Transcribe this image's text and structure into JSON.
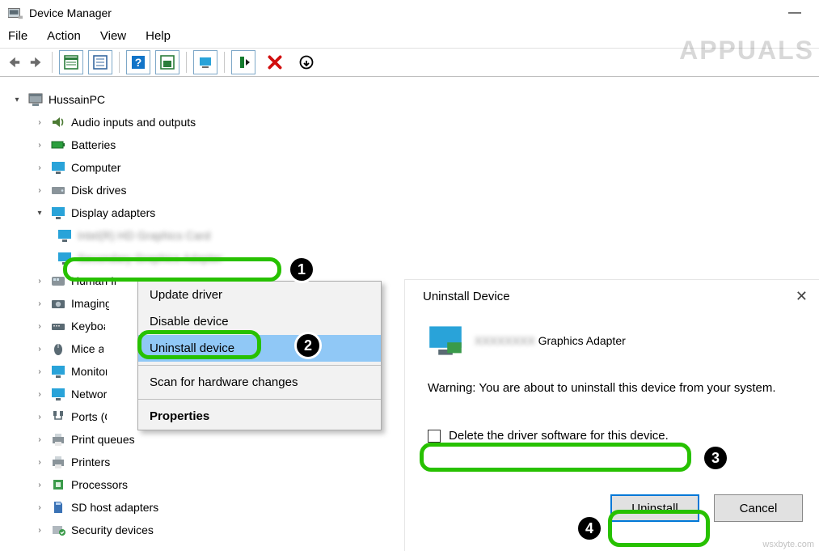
{
  "app": {
    "title": "Device Manager"
  },
  "menus": {
    "file": "File",
    "action": "Action",
    "view": "View",
    "help": "Help"
  },
  "tree": {
    "root": "HussainPC",
    "audio": "Audio inputs and outputs",
    "batteries": "Batteries",
    "computer": "Computer",
    "disk": "Disk drives",
    "display": "Display adapters",
    "da_item1": "Intel(R) HD Graphics Card",
    "da_item2": "Secondary Graphics Adapter",
    "hid": "Human Interface Devices",
    "imaging": "Imaging devices",
    "keyboards": "Keyboards",
    "mice": "Mice and other pointing devices",
    "monitors": "Monitors",
    "network": "Network adapters",
    "ports": "Ports (COM & LPT)",
    "printq": "Print queues",
    "printers": "Printers",
    "processors": "Processors",
    "sdhost": "SD host adapters",
    "security": "Security devices"
  },
  "context_menu": {
    "update": "Update driver",
    "disable": "Disable device",
    "uninstall": "Uninstall device",
    "scan": "Scan for hardware changes",
    "properties": "Properties"
  },
  "dialog": {
    "title": "Uninstall Device",
    "device_part_blur": "XXXXXXXX",
    "device_part_vis": " Graphics Adapter",
    "warning": "Warning: You are about to uninstall this device from your system.",
    "chk_label": "Delete the driver software for this device.",
    "uninstall_btn": "Uninstall",
    "cancel_btn": "Cancel"
  },
  "annotations": {
    "b1": "1",
    "b2": "2",
    "b3": "3",
    "b4": "4"
  },
  "watermark": {
    "text": "APPUALS",
    "corner": "wsxbyte.com"
  }
}
